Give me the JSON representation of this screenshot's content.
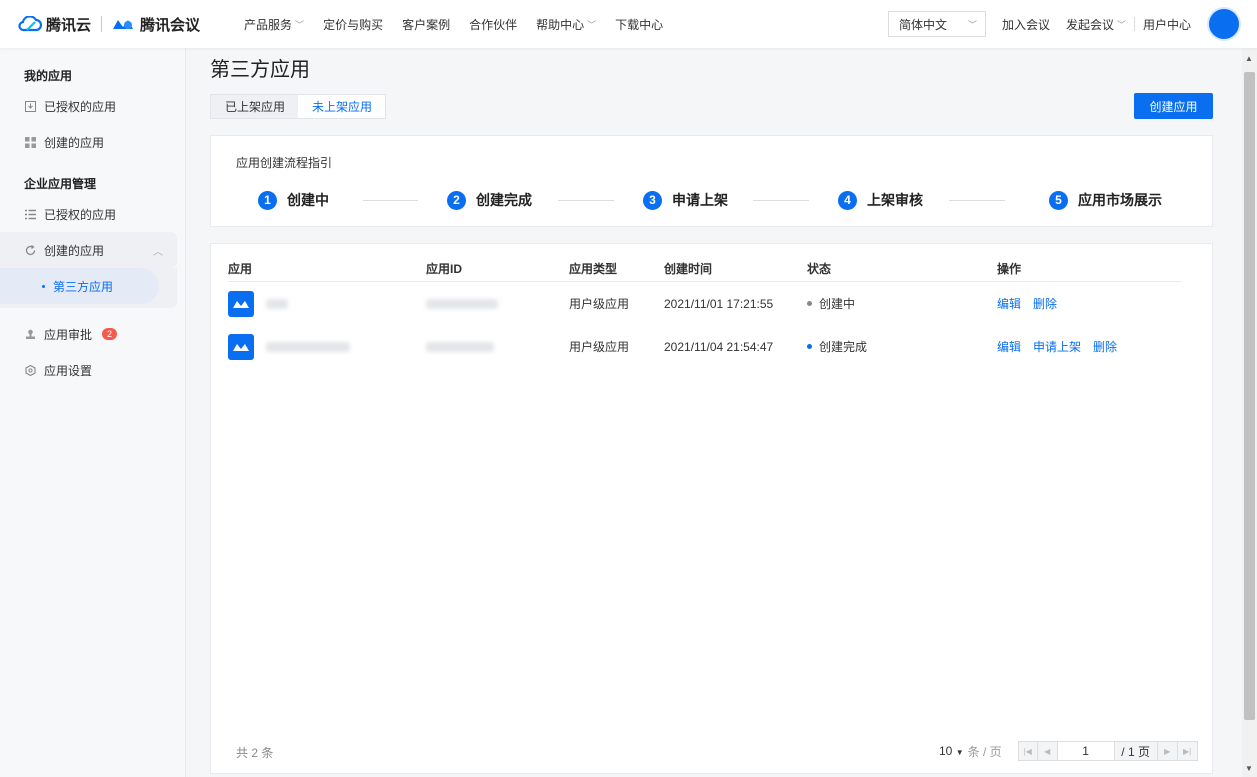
{
  "header": {
    "brand_cloud": "腾讯云",
    "brand_meeting": "腾讯会议",
    "nav": [
      {
        "label": "产品服务",
        "dropdown": true
      },
      {
        "label": "定价与购买",
        "dropdown": false
      },
      {
        "label": "客户案例",
        "dropdown": false
      },
      {
        "label": "合作伙伴",
        "dropdown": false
      },
      {
        "label": "帮助中心",
        "dropdown": true
      },
      {
        "label": "下载中心",
        "dropdown": false
      }
    ],
    "language": "简体中文",
    "join_meeting": "加入会议",
    "start_meeting": "发起会议",
    "user_center": "用户中心"
  },
  "sidebar": {
    "group_my_apps": "我的应用",
    "my_authorized": "已授权的应用",
    "my_created": "创建的应用",
    "group_enterprise": "企业应用管理",
    "ent_authorized": "已授权的应用",
    "ent_created": "创建的应用",
    "ent_third_party": "第三方应用",
    "app_approval": "应用审批",
    "app_approval_badge": "2",
    "app_settings": "应用设置"
  },
  "main": {
    "title": "第三方应用",
    "tab_listed": "已上架应用",
    "tab_unlisted": "未上架应用",
    "create_button": "创建应用",
    "guide_title": "应用创建流程指引",
    "steps": [
      {
        "num": "1",
        "label": "创建中"
      },
      {
        "num": "2",
        "label": "创建完成"
      },
      {
        "num": "3",
        "label": "申请上架"
      },
      {
        "num": "4",
        "label": "上架审核"
      },
      {
        "num": "5",
        "label": "应用市场展示"
      }
    ],
    "columns": [
      "应用",
      "应用ID",
      "应用类型",
      "创建时间",
      "状态",
      "操作"
    ],
    "rows": [
      {
        "type": "用户级应用",
        "created": "2021/11/01 17:21:55",
        "status": "创建中",
        "status_color": "#888888",
        "actions": [
          "编辑",
          "删除"
        ]
      },
      {
        "type": "用户级应用",
        "created": "2021/11/04 21:54:47",
        "status": "创建完成",
        "status_color": "#0a6ef0",
        "actions": [
          "编辑",
          "申请上架",
          "删除"
        ]
      }
    ],
    "total_text": "共 2 条",
    "page_size": "10",
    "page_size_unit": "条 / 页",
    "current_page": "1",
    "total_pages": "/ 1 页"
  },
  "colors": {
    "accent": "#0a6ef0",
    "badge": "#f35b4f"
  }
}
